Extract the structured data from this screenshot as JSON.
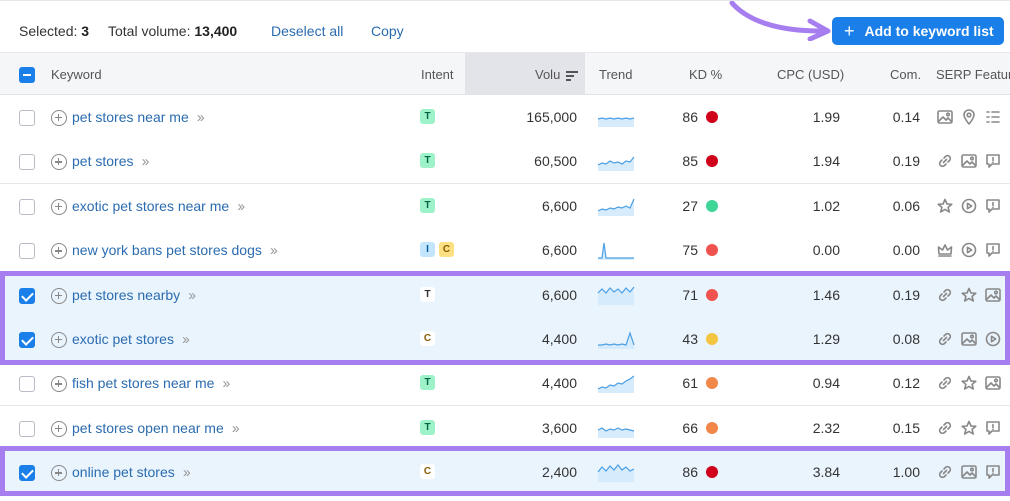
{
  "toolbar": {
    "selected_label": "Selected:",
    "selected_count": "3",
    "total_label": "Total volume:",
    "total_volume": "13,400",
    "deselect_label": "Deselect all",
    "copy_label": "Copy",
    "add_label": "Add to keyword list"
  },
  "columns": {
    "keyword": "Keyword",
    "intent": "Intent",
    "volume": "Volu",
    "trend": "Trend",
    "kd": "KD %",
    "cpc": "CPC (USD)",
    "com": "Com.",
    "serp": "SERP Feature"
  },
  "colors": {
    "accent": "#1a7fe8",
    "highlight": "#a77ef0",
    "kd_red": "#d0021b",
    "kd_orange": "#f2874a",
    "kd_yellow": "#f5c542",
    "kd_green": "#3dd598"
  },
  "rows": [
    {
      "checked": false,
      "keyword": "pet stores near me",
      "intent": [
        {
          "code": "T",
          "style": "T"
        }
      ],
      "volume": "165,000",
      "kd": "86",
      "kd_color": "#d0021b",
      "cpc": "1.99",
      "com": "0.14",
      "serp": [
        "image-icon",
        "pin-icon",
        "list-icon"
      ]
    },
    {
      "checked": false,
      "keyword": "pet stores",
      "intent": [
        {
          "code": "T",
          "style": "T"
        }
      ],
      "volume": "60,500",
      "kd": "85",
      "kd_color": "#d0021b",
      "cpc": "1.94",
      "com": "0.19",
      "serp": [
        "link-icon",
        "image-icon",
        "comment-icon"
      ]
    },
    {
      "checked": false,
      "keyword": "exotic pet stores near me",
      "intent": [
        {
          "code": "T",
          "style": "T"
        }
      ],
      "volume": "6,600",
      "kd": "27",
      "kd_color": "#3dd598",
      "cpc": "1.02",
      "com": "0.06",
      "serp": [
        "star-icon",
        "play-icon",
        "comment-icon"
      ]
    },
    {
      "checked": false,
      "keyword": "new york bans pet stores dogs",
      "intent": [
        {
          "code": "I",
          "style": "I"
        },
        {
          "code": "C",
          "style": "C"
        }
      ],
      "volume": "6,600",
      "kd": "75",
      "kd_color": "#f0524f",
      "cpc": "0.00",
      "com": "0.00",
      "serp": [
        "crown-icon",
        "play-icon",
        "comment-icon"
      ]
    },
    {
      "checked": true,
      "keyword": "pet stores nearby",
      "intent": [
        {
          "code": "T",
          "style": "Tw"
        }
      ],
      "volume": "6,600",
      "kd": "71",
      "kd_color": "#f0524f",
      "cpc": "1.46",
      "com": "0.19",
      "serp": [
        "link-icon",
        "star-icon",
        "image-icon"
      ]
    },
    {
      "checked": true,
      "keyword": "exotic pet stores",
      "intent": [
        {
          "code": "C",
          "style": "Cw"
        }
      ],
      "volume": "4,400",
      "kd": "43",
      "kd_color": "#f5c542",
      "cpc": "1.29",
      "com": "0.08",
      "serp": [
        "link-icon",
        "image-icon",
        "play-icon"
      ]
    },
    {
      "checked": false,
      "keyword": "fish pet stores near me",
      "intent": [
        {
          "code": "T",
          "style": "T"
        }
      ],
      "volume": "4,400",
      "kd": "61",
      "kd_color": "#f2874a",
      "cpc": "0.94",
      "com": "0.12",
      "serp": [
        "link-icon",
        "star-icon",
        "image-icon"
      ]
    },
    {
      "checked": false,
      "keyword": "pet stores open near me",
      "intent": [
        {
          "code": "T",
          "style": "T"
        }
      ],
      "volume": "3,600",
      "kd": "66",
      "kd_color": "#f2874a",
      "cpc": "2.32",
      "com": "0.15",
      "serp": [
        "link-icon",
        "star-icon",
        "comment-icon"
      ]
    },
    {
      "checked": true,
      "keyword": "online pet stores",
      "intent": [
        {
          "code": "C",
          "style": "Cw"
        }
      ],
      "volume": "2,400",
      "kd": "86",
      "kd_color": "#d0021b",
      "cpc": "3.84",
      "com": "1.00",
      "serp": [
        "link-icon",
        "image-icon",
        "comment-icon"
      ]
    }
  ]
}
